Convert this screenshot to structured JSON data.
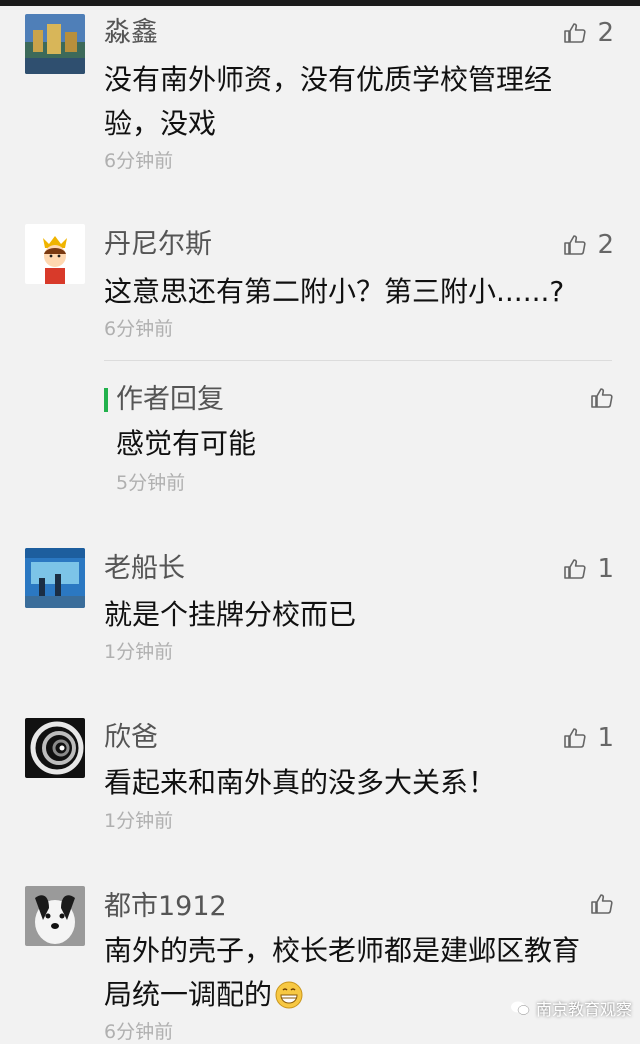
{
  "comments": [
    {
      "name": "淼鑫",
      "content": "没有南外师资，没有优质学校管理经验，没戏",
      "time": "6分钟前",
      "likes": "2",
      "avatar_icon": "landscape-avatar-icon"
    },
    {
      "name": "丹尼尔斯",
      "content": "这意思还有第二附小？第三附小......?",
      "time": "6分钟前",
      "likes": "2",
      "avatar_icon": "cartoon-prince-avatar-icon",
      "reply": {
        "label": "作者回复",
        "content": "感觉有可能",
        "time": "5分钟前"
      }
    },
    {
      "name": "老船长",
      "content": "就是个挂牌分校而已",
      "time": "1分钟前",
      "likes": "1",
      "avatar_icon": "scene-avatar-icon"
    },
    {
      "name": "欣爸",
      "content": "看起来和南外真的没多大关系！",
      "time": "1分钟前",
      "likes": "1",
      "avatar_icon": "spiral-staircase-avatar-icon"
    },
    {
      "name": "都市1912",
      "content": "南外的壳子，校长老师都是建邺区教育局统一调配的",
      "time": "6分钟前",
      "likes": "",
      "avatar_icon": "dog-avatar-icon",
      "emoji": "grinning-emoji-icon"
    }
  ],
  "watermark": "南京教育观察",
  "colors": {
    "reply_accent": "#22b14c",
    "time_text": "#b0b0b0",
    "name_text": "#555555",
    "background": "#f2f2f2"
  }
}
